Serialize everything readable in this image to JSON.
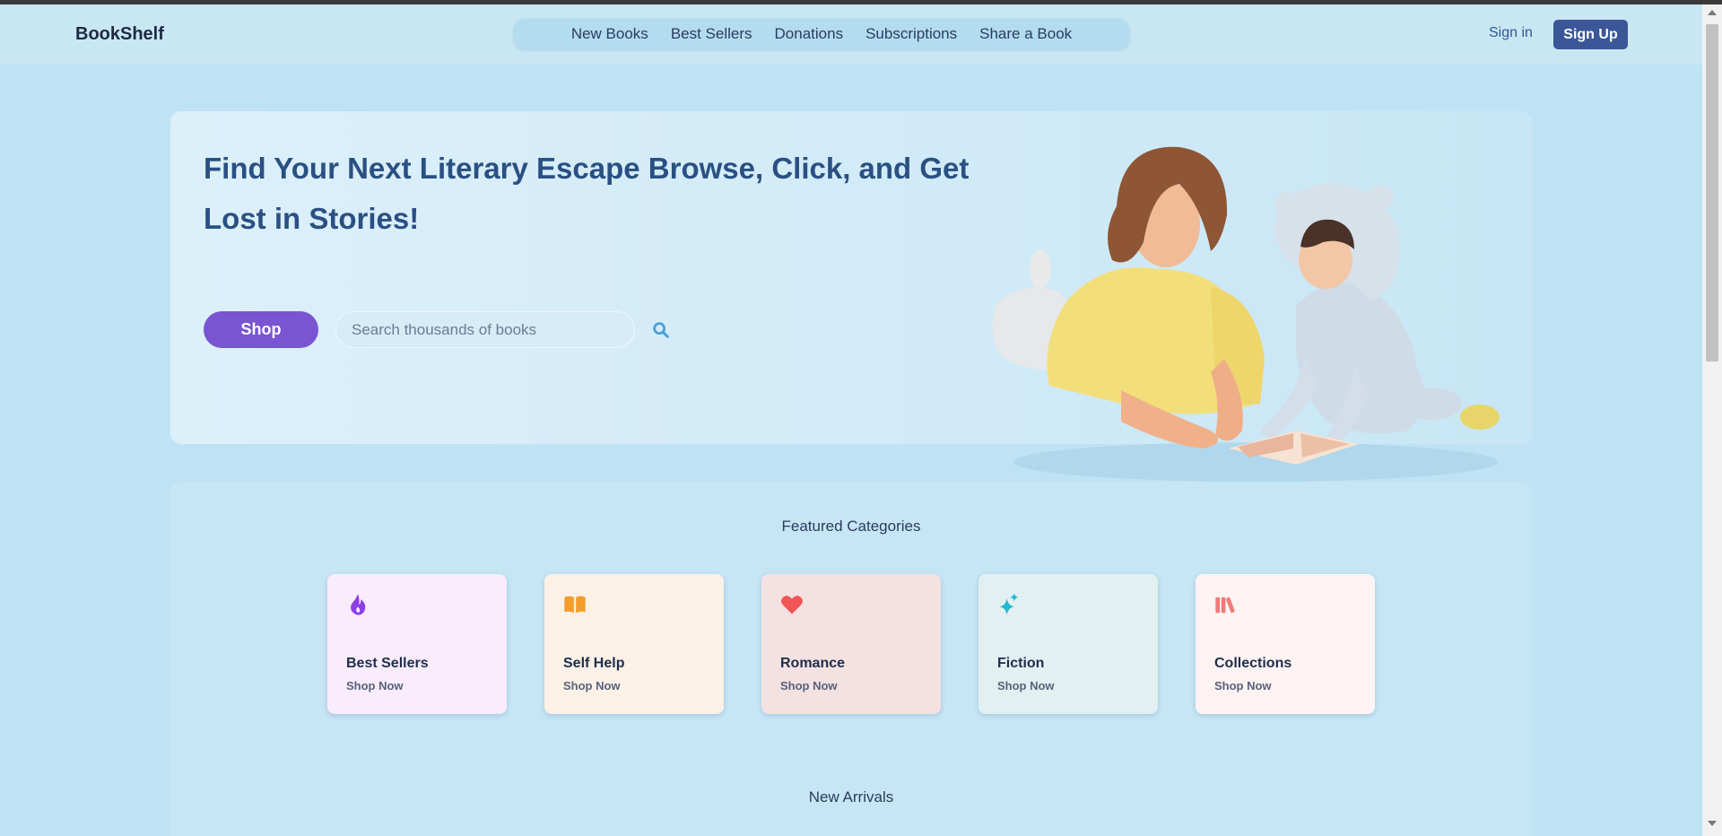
{
  "header": {
    "brand": "BookShelf",
    "nav": [
      "New Books",
      "Best Sellers",
      "Donations",
      "Subscriptions",
      "Share a Book"
    ],
    "signin_label": "Sign in",
    "signup_label": "Sign Up"
  },
  "hero": {
    "title": "Find Your Next Literary Escape Browse, Click, and Get Lost in Stories!",
    "shop_label": "Shop",
    "search_placeholder": "Search thousands of books",
    "illustration": "woman-and-child-reading-book"
  },
  "featured": {
    "title": "Featured Categories",
    "categories": [
      {
        "title": "Best Sellers",
        "link": "Shop Now",
        "icon": "fire-icon",
        "bg": "#f8ecfd",
        "icon_color": "#8b3fe3"
      },
      {
        "title": "Self Help",
        "link": "Shop Now",
        "icon": "open-book-icon",
        "bg": "#fcf1e6",
        "icon_color": "#f39d2b"
      },
      {
        "title": "Romance",
        "link": "Shop Now",
        "icon": "heart-icon",
        "bg": "#f4e1e1",
        "icon_color": "#f05656"
      },
      {
        "title": "Fiction",
        "link": "Shop Now",
        "icon": "sparkles-icon",
        "bg": "#e2f0f1",
        "icon_color": "#1fb8d6"
      },
      {
        "title": "Collections",
        "link": "Shop Now",
        "icon": "books-icon",
        "bg": "#fef3f3",
        "icon_color": "#f07b7b"
      }
    ],
    "new_arrivals_title": "New Arrivals"
  },
  "colors": {
    "page_bg": "#bfe3f5",
    "accent": "#7a55d2",
    "signup_bg": "#3b5797",
    "title": "#2a5083"
  }
}
